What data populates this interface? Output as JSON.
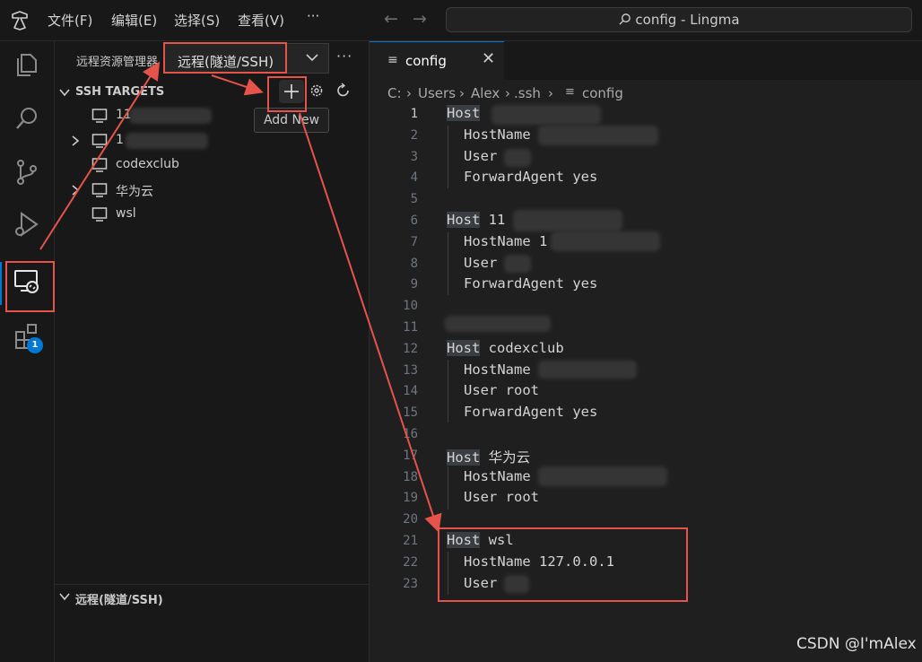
{
  "titlebar": {
    "menus": [
      "文件(F)",
      "编辑(E)",
      "选择(S)",
      "查看(V)"
    ],
    "more": "···",
    "command_center": "config - Lingma"
  },
  "sidebar": {
    "title": "远程资源管理器",
    "select_value": "远程(隧道/SSH)",
    "more": "···",
    "section_ssh": "SSH TARGETS",
    "tooltip": "Add New",
    "targets": [
      {
        "label": "11",
        "expandable": false
      },
      {
        "label": "1",
        "expandable": true
      },
      {
        "label": "codexclub",
        "expandable": false
      },
      {
        "label": "华为云",
        "expandable": true
      },
      {
        "label": "wsl",
        "expandable": false
      }
    ],
    "section_bottom": "远程(隧道/SSH)"
  },
  "activity": {
    "badge": "1"
  },
  "editor": {
    "tab_label": "config",
    "tab_close": "✕",
    "breadcrumb": [
      "C:",
      "Users",
      "Alex",
      ".ssh",
      "config"
    ],
    "lines": [
      {
        "n": "1",
        "kw": "Host",
        "rest": ""
      },
      {
        "n": "2",
        "kw": "",
        "rest": "HostName"
      },
      {
        "n": "3",
        "kw": "",
        "rest": "User"
      },
      {
        "n": "4",
        "kw": "",
        "rest": "ForwardAgent yes"
      },
      {
        "n": "5",
        "kw": "",
        "rest": ""
      },
      {
        "n": "6",
        "kw": "Host",
        "rest": " 11"
      },
      {
        "n": "7",
        "kw": "",
        "rest": "HostName 1"
      },
      {
        "n": "8",
        "kw": "",
        "rest": "User"
      },
      {
        "n": "9",
        "kw": "",
        "rest": "ForwardAgent yes"
      },
      {
        "n": "10",
        "kw": "",
        "rest": ""
      },
      {
        "n": "11",
        "kw": "",
        "rest": ""
      },
      {
        "n": "12",
        "kw": "Host",
        "rest": " codexclub"
      },
      {
        "n": "13",
        "kw": "",
        "rest": "HostName"
      },
      {
        "n": "14",
        "kw": "",
        "rest": "User root"
      },
      {
        "n": "15",
        "kw": "",
        "rest": "ForwardAgent yes"
      },
      {
        "n": "16",
        "kw": "",
        "rest": ""
      },
      {
        "n": "17",
        "kw": "Host",
        "rest": " 华为云"
      },
      {
        "n": "18",
        "kw": "",
        "rest": "HostName"
      },
      {
        "n": "19",
        "kw": "",
        "rest": "User root"
      },
      {
        "n": "20",
        "kw": "",
        "rest": ""
      },
      {
        "n": "21",
        "kw": "Host",
        "rest": " wsl"
      },
      {
        "n": "22",
        "kw": "",
        "rest": "HostName 127.0.0.1"
      },
      {
        "n": "23",
        "kw": "",
        "rest": "User"
      }
    ]
  },
  "watermark": "CSDN @I'mAlex",
  "colors": {
    "accent": "#0078d4",
    "annotation": "#e5534b"
  }
}
